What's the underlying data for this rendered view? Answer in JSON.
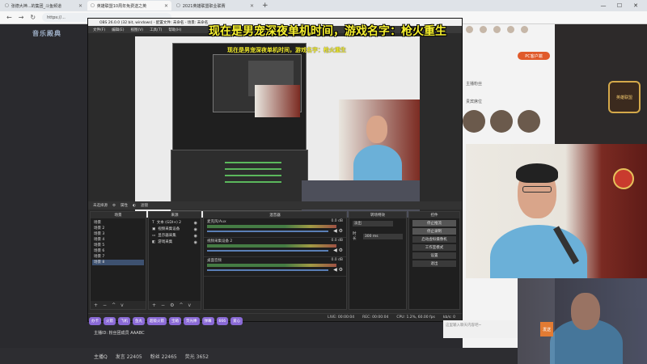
{
  "browser": {
    "tabs": [
      {
        "label": "张德大神...的集团_斗鱼频道",
        "icon": "page-icon"
      },
      {
        "label": "英雄联盟10周年免费送之英",
        "icon": "page-icon"
      },
      {
        "label": "2021英雄联盟职业联赛",
        "icon": "page-icon"
      }
    ],
    "url": "https://...",
    "new_tab": "+",
    "win_min": "—",
    "win_max": "☐",
    "win_close": "✕"
  },
  "overlay_title": "现在是男宠深夜单机时间，游戏名字：枪火重生",
  "site_logo": "音乐殿典",
  "obs": {
    "title": "OBS 26.0.0 (32 bit, windows) - 配置文件: 未命名 - 场景: 未命名",
    "menu": [
      "文件(F)",
      "编辑(E)",
      "视图(V)",
      "工具(T)",
      "帮助(H)"
    ],
    "inner_title": "现在是男宠深夜单机时间，游戏名字：枪火重生",
    "status": [
      "未选择源",
      "属性",
      "滤镜"
    ],
    "scenes_header": "场景",
    "scenes": [
      "场景",
      "场景 2",
      "场景 3",
      "场景 4",
      "场景 5",
      "场景 6",
      "场景 7",
      "场景 8"
    ],
    "selected_scene": 7,
    "sources_header": "来源",
    "sources": [
      {
        "icon": "text-icon",
        "glyph": "T",
        "label": "文本 (GDI+) 2"
      },
      {
        "icon": "camera-icon",
        "glyph": "▣",
        "label": "视频采集设备"
      },
      {
        "icon": "monitor-icon",
        "glyph": "▭",
        "label": "显示器采集"
      },
      {
        "icon": "game-icon",
        "glyph": "◧",
        "label": "游戏采集"
      }
    ],
    "mixer_header": "混音器",
    "mixer": [
      {
        "name": "麦克风/Aux",
        "db": "0.0 dB"
      },
      {
        "name": "视频采集设备 2",
        "db": "0.0 dB"
      },
      {
        "name": "桌面音频",
        "db": "0.0 dB"
      }
    ],
    "transitions_header": "转场特效",
    "transition_value": "淡出",
    "duration_label": "时长",
    "duration_value": "300 ms",
    "controls_header": "控件",
    "controls": [
      "停止推流",
      "停止录制",
      "启动虚拟摄像机",
      "工作室模式",
      "设置",
      "退出"
    ],
    "bottom_status": [
      "LIVE: 00:00:04",
      "REC: 00:00:04",
      "CPU: 1.2%, 60.00 fps",
      "kb/s: 0"
    ]
  },
  "right_panel": {
    "pc_button": "PC客户端",
    "badge": "英雄联盟",
    "rows": [
      "主播粉丝",
      "贵宾席位"
    ]
  },
  "chat": {
    "gifts": [
      "办卡",
      "火箭",
      "飞机",
      "鱼丸",
      "超级火箭",
      "宝箱",
      "荧光棒",
      "弹幕",
      "666",
      "爱心"
    ],
    "message": "主播ID: 粉丝团成员 AAABC",
    "input_placeholder": "这里输入聊天内容吧~",
    "send_label": "发送",
    "footer": [
      "主播Q",
      "发言 22405",
      "粉丝 22465",
      "荧光 3652"
    ]
  }
}
